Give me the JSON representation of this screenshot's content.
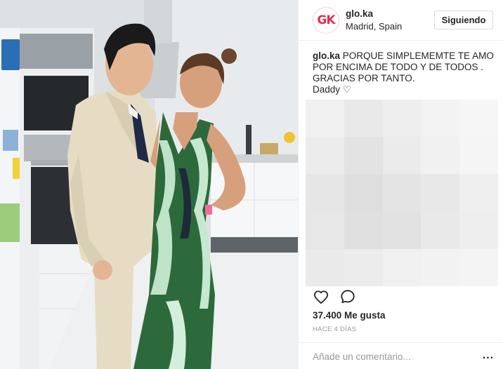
{
  "post": {
    "photo_description_icon": "photo-icon"
  },
  "author": {
    "avatar_text": "GK",
    "username": "glo.ka",
    "location": "Madrid, Spain",
    "follow_label": "Siguiendo"
  },
  "caption": {
    "username": "glo.ka",
    "lines": [
      "PORQUE SIMPLEMEMTE TE AMO",
      "POR ENCIMA DE TODO Y DE TODOS .",
      "GRACIAS POR TANTO.",
      "Daddy ♡"
    ]
  },
  "actions": {
    "like_icon": "heart-icon",
    "comment_icon": "comment-icon"
  },
  "likes": "37.400 Me gusta",
  "timestamp": "HACE 4 DÍAS",
  "comment_box": {
    "placeholder": "Añade un comentario...",
    "more_label": "..."
  },
  "colors": {
    "accent": "#e0314f",
    "text": "#262626",
    "muted": "#999999",
    "border": "#efefef"
  }
}
